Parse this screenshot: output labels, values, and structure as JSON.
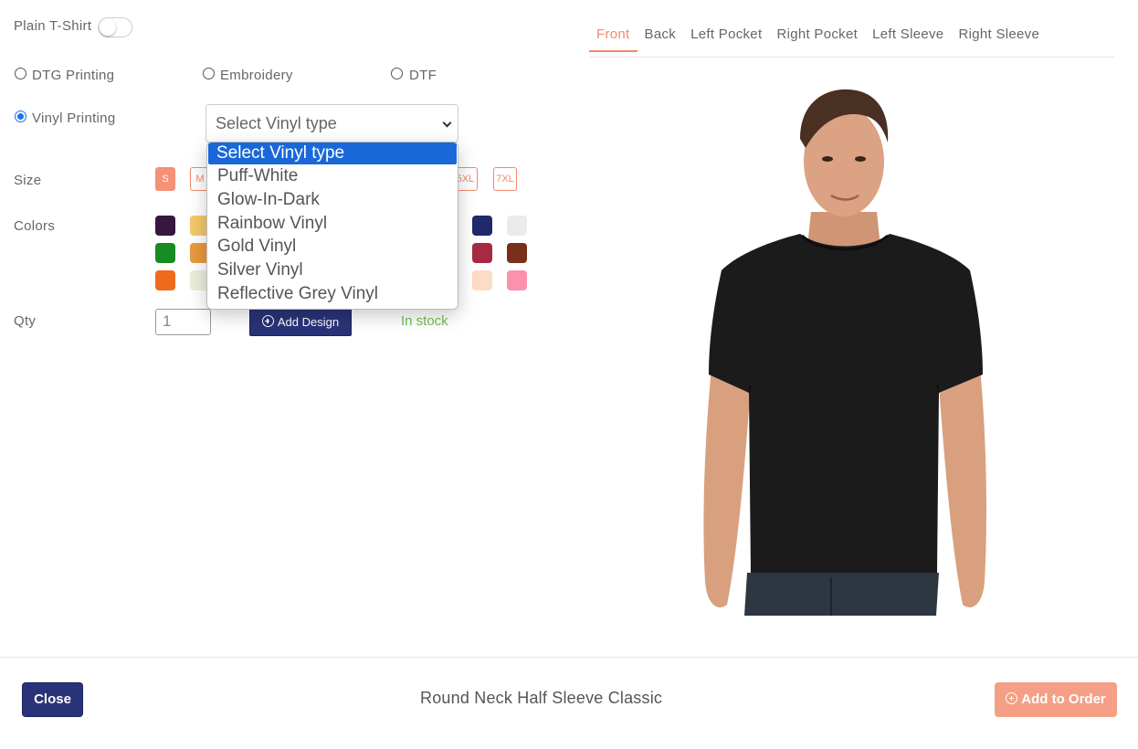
{
  "options": {
    "plain_tshirt_label": "Plain T-Shirt",
    "print_methods": [
      {
        "label": "DTG Printing",
        "checked": false
      },
      {
        "label": "Embroidery",
        "checked": false
      },
      {
        "label": "DTF",
        "checked": false
      },
      {
        "label": "Vinyl Printing",
        "checked": true
      }
    ],
    "vinyl_select": {
      "value": "Select Vinyl type",
      "options": [
        "Select Vinyl type",
        "Puff-White",
        "Glow-In-Dark",
        "Rainbow Vinyl",
        "Gold Vinyl",
        "Silver Vinyl",
        "Reflective Grey Vinyl"
      ]
    },
    "size_label": "Size",
    "sizes": [
      "S",
      "M",
      "5XL",
      "7XL"
    ],
    "selected_size": "S",
    "colors_label": "Colors",
    "colors": [
      "#37173f",
      "#f2c96a",
      "#1f2a6b",
      "#ebebeb",
      "#178c22",
      "#e89a3b",
      "#a72a43",
      "#7a2e1c",
      "#ef6a1c",
      "#eceedd",
      "#fddcc5",
      "#fb91ad"
    ],
    "qty_label": "Qty",
    "qty_value": "1",
    "add_design_label": "Add Design",
    "stock_status": "In stock",
    "stock_color": "#6cbf4a"
  },
  "view_tabs": [
    {
      "label": "Front",
      "active": true
    },
    {
      "label": "Back",
      "active": false
    },
    {
      "label": "Left Pocket",
      "active": false
    },
    {
      "label": "Right Pocket",
      "active": false
    },
    {
      "label": "Left Sleeve",
      "active": false
    },
    {
      "label": "Right Sleeve",
      "active": false
    }
  ],
  "preview": {
    "shirt_color": "#1b1b1b"
  },
  "footer": {
    "close_label": "Close",
    "product_name": "Round Neck Half Sleeve Classic",
    "add_to_order_label": "Add to Order"
  },
  "theme": {
    "accent": "#f4876b",
    "primary_navy": "#2b3378",
    "select_highlight": "#1a68d8"
  }
}
